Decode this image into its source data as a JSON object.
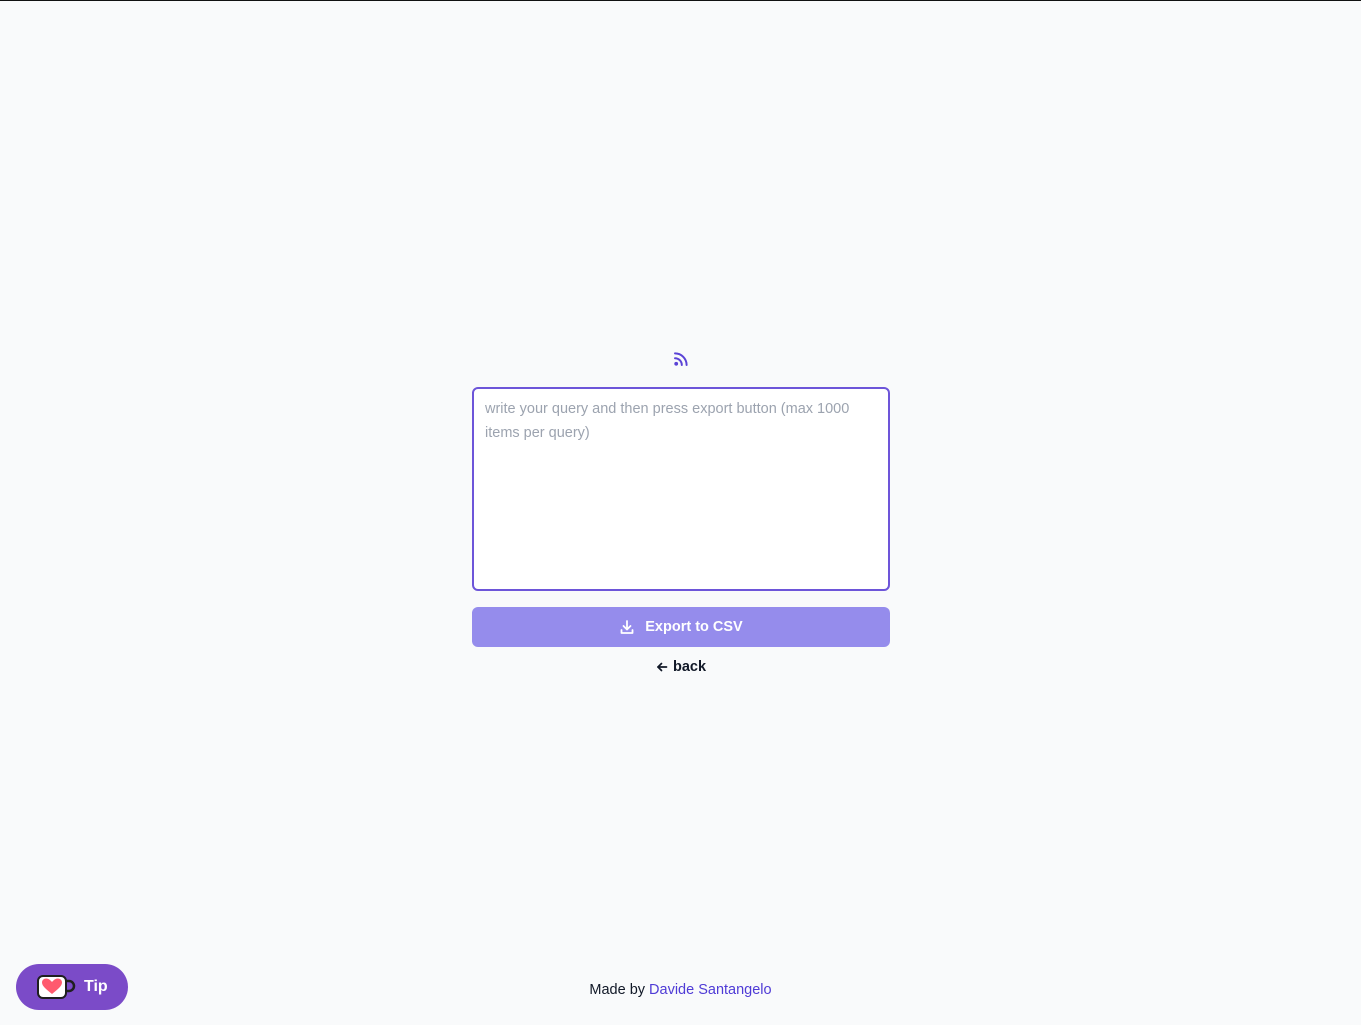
{
  "query": {
    "placeholder": "write your query and then press export button (max 1000 items per query)",
    "value": ""
  },
  "export_button": {
    "label": "Export to CSV"
  },
  "back_link": {
    "label": "back"
  },
  "footer": {
    "prefix": "Made by ",
    "author": "Davide Santangelo"
  },
  "tip_button": {
    "label": "Tip"
  },
  "icons": {
    "top": "rss-icon",
    "export": "download-icon",
    "back": "arrow-left-icon",
    "tip": "coffee-cup-heart-icon"
  },
  "colors": {
    "accent": "#6d55d9",
    "button_bg": "#958cec",
    "link": "#4f3bd6",
    "tip_bg": "#7b4bc8",
    "page_bg": "#f9fafb"
  }
}
